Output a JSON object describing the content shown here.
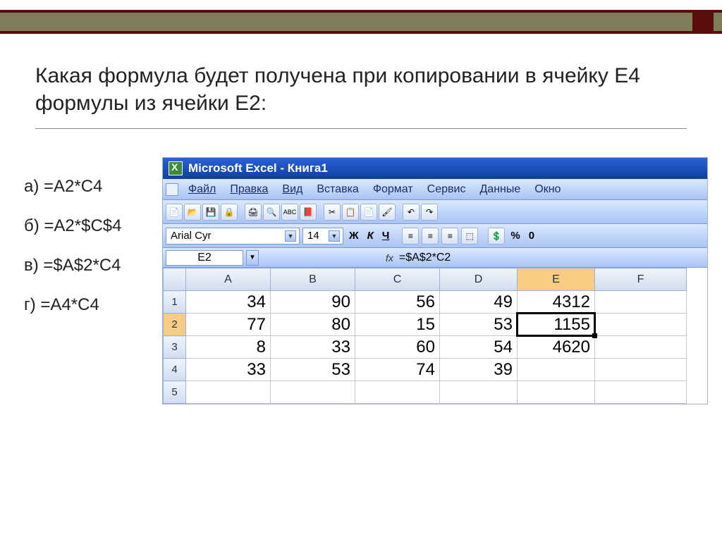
{
  "question": "Какая формула будет получена при копировании в ячейку E4 формулы из ячейки E2:",
  "options": {
    "a": "а) =A2*C4",
    "b": "б) =A2*$C$4",
    "c": "в) =$A$2*C4",
    "d": "г) =A4*C4"
  },
  "excel": {
    "title": "Microsoft Excel - Книга1",
    "menu": {
      "file": "Файл",
      "edit": "Правка",
      "view": "Вид",
      "insert": "Вставка",
      "format": "Формат",
      "tools": "Сервис",
      "data": "Данные",
      "window": "Окно"
    },
    "font_name": "Arial Cyr",
    "font_size": "14",
    "bold": "Ж",
    "italic": "К",
    "underline": "Ч",
    "percent": "%",
    "zero": "0",
    "name_box": "E2",
    "formula": "=$A$2*C2",
    "columns": [
      "A",
      "B",
      "C",
      "D",
      "E",
      "F"
    ],
    "rows": [
      {
        "n": "1",
        "A": "34",
        "B": "90",
        "C": "56",
        "D": "49",
        "E": "4312",
        "F": ""
      },
      {
        "n": "2",
        "A": "77",
        "B": "80",
        "C": "15",
        "D": "53",
        "E": "1155",
        "F": ""
      },
      {
        "n": "3",
        "A": "8",
        "B": "33",
        "C": "60",
        "D": "54",
        "E": "4620",
        "F": ""
      },
      {
        "n": "4",
        "A": "33",
        "B": "53",
        "C": "74",
        "D": "39",
        "E": "",
        "F": ""
      },
      {
        "n": "5",
        "A": "",
        "B": "",
        "C": "",
        "D": "",
        "E": "",
        "F": ""
      }
    ]
  }
}
